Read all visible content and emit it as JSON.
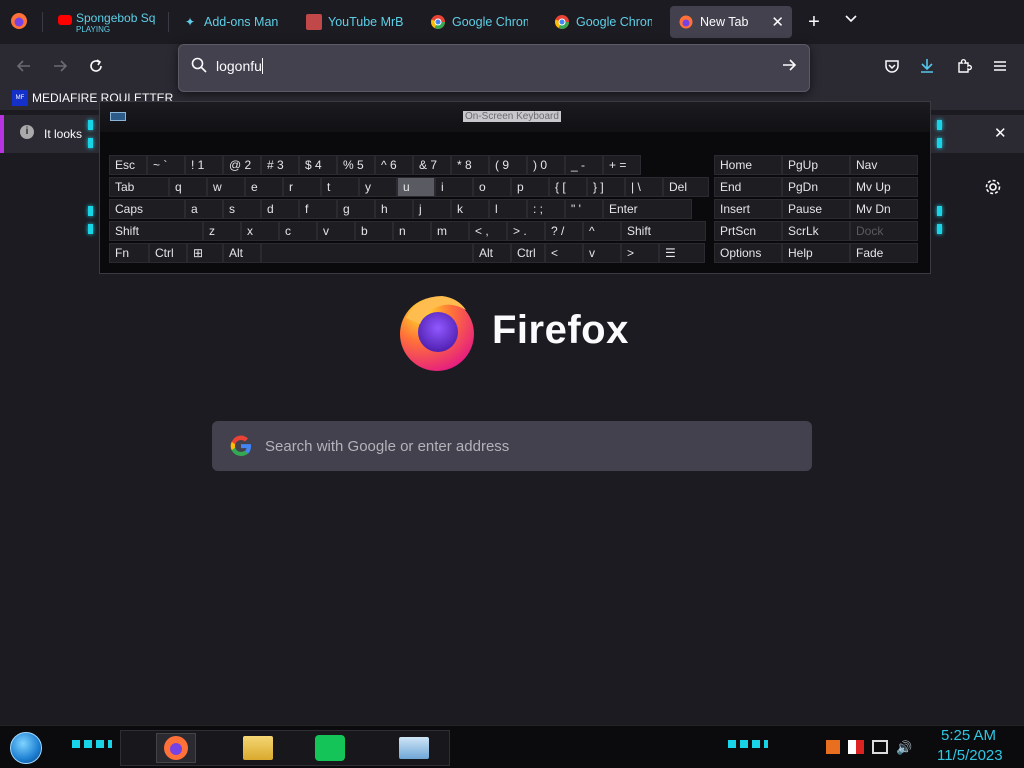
{
  "tabs": [
    {
      "label": "Spongebob Sq",
      "sublabel": "PLAYING",
      "icon": "youtube-icon"
    },
    {
      "label": "Add-ons Mana",
      "icon": "puzzle-icon"
    },
    {
      "label": "YouTube MrBea",
      "icon": "image-icon"
    },
    {
      "label": "Google Chrom",
      "icon": "chrome-icon"
    },
    {
      "label": "Google Chrom",
      "icon": "chrome-icon"
    },
    {
      "label": "New Tab",
      "icon": "firefox-icon",
      "selected": true
    }
  ],
  "urlbar": {
    "value": "logonfu"
  },
  "bookmarks": {
    "item": "MEDIAFIRE ROULETTER"
  },
  "notification": {
    "text": "It looks"
  },
  "osk": {
    "title": "On-Screen Keyboard",
    "rows": [
      [
        "Esc",
        "~ `",
        "! 1",
        "@ 2",
        "# 3",
        "$ 4",
        "% 5",
        "^ 6",
        "& 7",
        "* 8",
        "( 9",
        ") 0",
        "_ -",
        "+ ="
      ],
      [
        "Tab",
        "q",
        "w",
        "e",
        "r",
        "t",
        "y",
        "u",
        "i",
        "o",
        "p",
        "{ [",
        "} ]",
        "| \\",
        "Del"
      ],
      [
        "Caps",
        "a",
        "s",
        "d",
        "f",
        "g",
        "h",
        "j",
        "k",
        "l",
        ": ;",
        "\" '",
        "Enter"
      ],
      [
        "Shift",
        "z",
        "x",
        "c",
        "v",
        "b",
        "n",
        "m",
        "< ,",
        "> .",
        "? /",
        "^",
        "Shift"
      ],
      [
        "Fn",
        "Ctrl",
        "⊞",
        "Alt",
        "",
        "Alt",
        "Ctrl",
        "<",
        "v",
        ">",
        "☰"
      ]
    ],
    "nav": [
      [
        "Home",
        "PgUp",
        "Nav"
      ],
      [
        "End",
        "PgDn",
        "Mv Up"
      ],
      [
        "Insert",
        "Pause",
        "Mv Dn"
      ],
      [
        "PrtScn",
        "ScrLk",
        "Dock"
      ],
      [
        "Options",
        "Help",
        "Fade"
      ]
    ]
  },
  "newtab": {
    "wordmark": "Firefox",
    "search_placeholder": "Search with Google or enter address"
  },
  "taskbar": {
    "time": "5:25 AM",
    "date": "11/5/2023"
  }
}
